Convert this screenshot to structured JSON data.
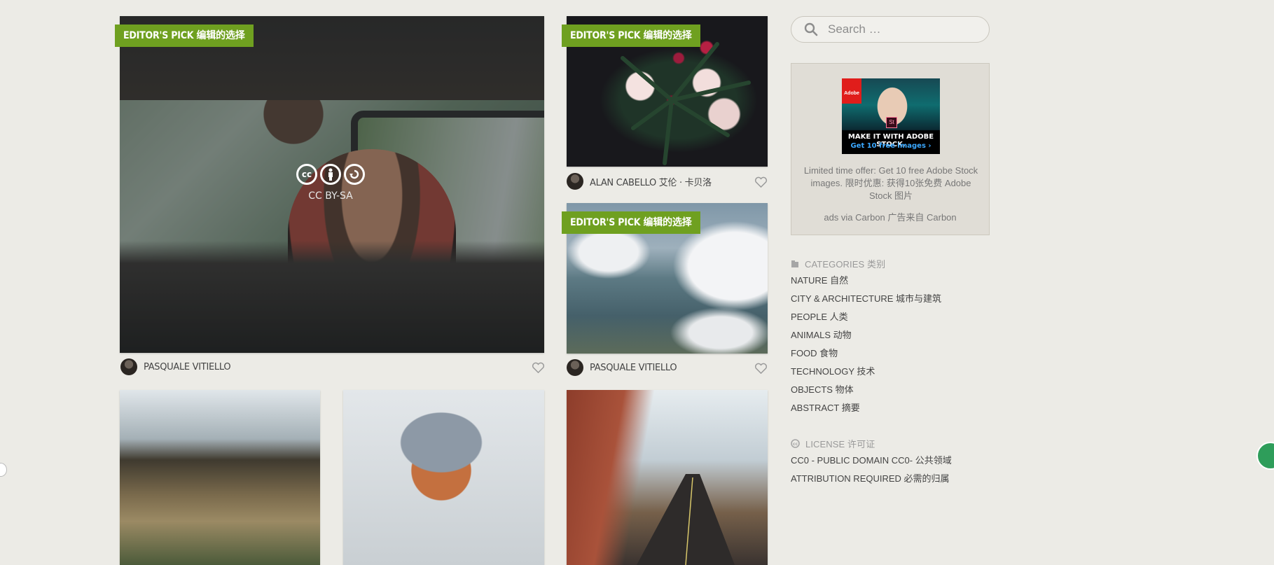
{
  "badge_label": "EDITOR'S PICK 编辑的选择",
  "cards": {
    "main": {
      "author": "PASQUALE VITIELLO",
      "license": "CC BY-SA",
      "license_icons": [
        "cc-icon",
        "by-icon",
        "sa-icon"
      ]
    },
    "flowers": {
      "author": "ALAN CABELLO 艾伦 · 卡贝洛"
    },
    "clouds": {
      "author": "PASQUALE VITIELLO"
    }
  },
  "search": {
    "placeholder": "Search …"
  },
  "ad": {
    "brand": "Adobe",
    "product_badge": "St",
    "headline": "MAKE IT WITH ADOBE STOCK.",
    "cta": "Get 10 free images ›",
    "text": "Limited time offer: Get 10 free Adobe Stock images. 限时优惠: 获得10张免费 Adobe Stock 图片",
    "via": "ads via Carbon 广告来自 Carbon"
  },
  "categories": {
    "title": "CATEGORIES 类别",
    "items": [
      "NATURE 自然",
      "CITY & ARCHITECTURE 城市与建筑",
      "PEOPLE 人类",
      "ANIMALS 动物",
      "FOOD 食物",
      "TECHNOLOGY 技术",
      "OBJECTS 物体",
      "ABSTRACT 摘要"
    ]
  },
  "license": {
    "title": "LICENSE 许可证",
    "items": [
      "CC0 - PUBLIC DOMAIN CC0- 公共领域",
      "ATTRIBUTION REQUIRED 必需的归属"
    ]
  },
  "colors": {
    "accent_green": "#6fa020",
    "background": "#ecebe6"
  }
}
